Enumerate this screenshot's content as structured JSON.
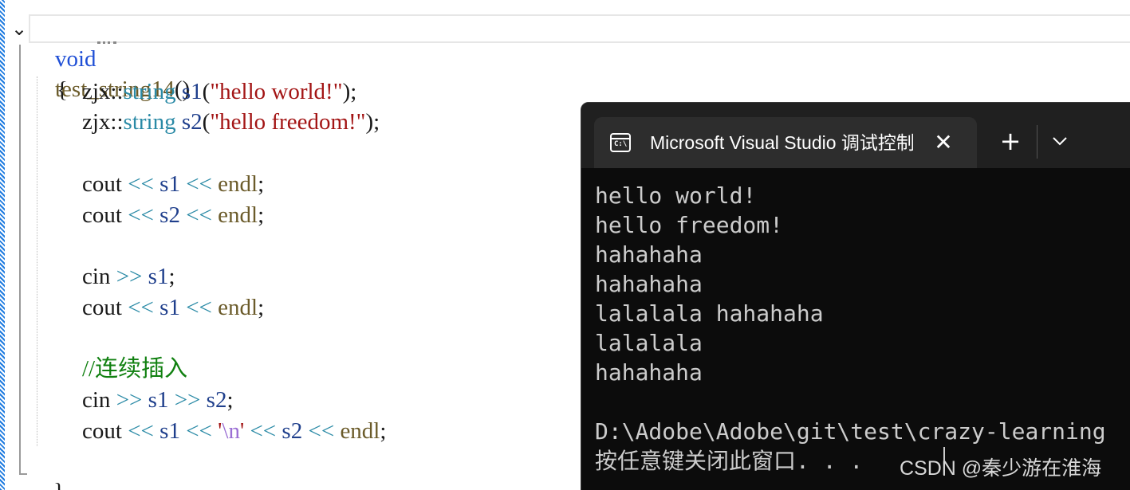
{
  "editor": {
    "header": {
      "kw": "void",
      "fn": "test_string14",
      "paren": "()"
    },
    "open_brace": "{",
    "close_brace": "}",
    "lines": {
      "l1": {
        "ns": "zjx::",
        "type": "string",
        "var": "s1",
        "open": "(",
        "str": "\"hello world!\"",
        "close": ");"
      },
      "l2": {
        "ns": "zjx::",
        "type": "string",
        "var": "s2",
        "open": "(",
        "str": "\"hello freedom!\"",
        "close": ");"
      },
      "l3": {
        "a": "cout",
        "op1": "<<",
        "v": "s1",
        "op2": "<<",
        "e": "endl",
        "end": ";"
      },
      "l4": {
        "a": "cout",
        "op1": "<<",
        "v": "s2",
        "op2": "<<",
        "e": "endl",
        "end": ";"
      },
      "l5": {
        "a": "cin",
        "op1": ">>",
        "v": "s1",
        "end": ";"
      },
      "l6": {
        "a": "cout",
        "op1": "<<",
        "v": "s1",
        "op2": "<<",
        "e": "endl",
        "end": ";"
      },
      "comment": "//连续插入",
      "l7": {
        "a": "cin",
        "op1": ">>",
        "v1": "s1",
        "op2": ">>",
        "v2": "s2",
        "end": ";"
      },
      "l8": {
        "a": "cout",
        "op1": "<<",
        "v1": "s1",
        "op2": "<<",
        "q1": "'",
        "esc": "\\n",
        "q2": "'",
        "op3": "<<",
        "v2": "s2",
        "op4": "<<",
        "e": "endl",
        "end": ";"
      }
    }
  },
  "terminal": {
    "tab_title": "Microsoft Visual Studio 调试控制台",
    "icon_text": "C:\\",
    "close_glyph": "✕",
    "new_tab_glyph": "+",
    "output": [
      "hello world!",
      "hello freedom!",
      "hahahaha",
      "hahahaha",
      "lalalala hahahaha",
      "lalalala",
      "hahahaha",
      "",
      "D:\\Adobe\\Adobe\\git\\test\\crazy-learning",
      "按任意键关闭此窗口. . ."
    ]
  },
  "watermark": "CSDN @秦少游在淮海",
  "colors": {
    "keyword": "#1f4fd6",
    "type": "#2a8aa6",
    "string": "#a31515",
    "comment": "#108010",
    "terminal_bg": "#0c0c0c"
  }
}
